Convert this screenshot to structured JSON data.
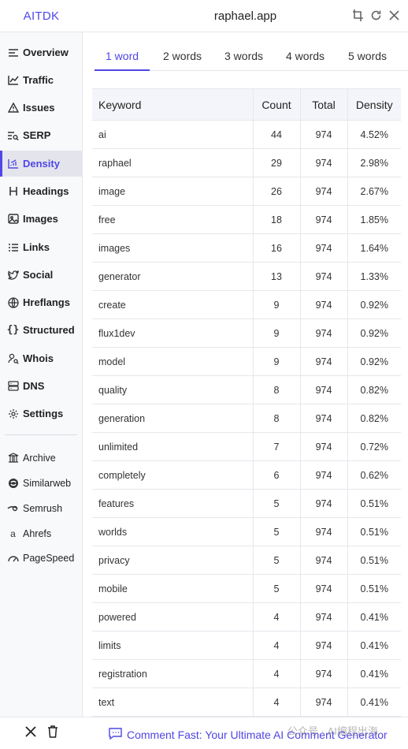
{
  "header": {
    "brand": "AITDK",
    "domain": "raphael.app"
  },
  "sidebar": {
    "items": [
      {
        "label": "Overview",
        "icon": "list-icon"
      },
      {
        "label": "Traffic",
        "icon": "chart-line-icon"
      },
      {
        "label": "Issues",
        "icon": "warning-icon"
      },
      {
        "label": "SERP",
        "icon": "serp-icon"
      },
      {
        "label": "Density",
        "icon": "density-chart-icon",
        "active": true
      },
      {
        "label": "Headings",
        "icon": "heading-icon"
      },
      {
        "label": "Images",
        "icon": "image-icon"
      },
      {
        "label": "Links",
        "icon": "links-list-icon"
      },
      {
        "label": "Social",
        "icon": "twitter-icon"
      },
      {
        "label": "Hreflangs",
        "icon": "globe-icon"
      },
      {
        "label": "Structured",
        "icon": "braces-icon"
      },
      {
        "label": "Whois",
        "icon": "user-search-icon"
      },
      {
        "label": "DNS",
        "icon": "server-icon"
      },
      {
        "label": "Settings",
        "icon": "gear-icon"
      }
    ],
    "external": [
      {
        "label": "Archive",
        "icon": "archive-icon"
      },
      {
        "label": "Similarweb",
        "icon": "similarweb-icon"
      },
      {
        "label": "Semrush",
        "icon": "semrush-icon"
      },
      {
        "label": "Ahrefs",
        "icon": "ahrefs-icon"
      },
      {
        "label": "PageSpeed",
        "icon": "pagespeed-icon"
      }
    ]
  },
  "tabs": [
    "1 word",
    "2 words",
    "3 words",
    "4 words",
    "5 words"
  ],
  "table": {
    "headers": {
      "keyword": "Keyword",
      "count": "Count",
      "total": "Total",
      "density": "Density"
    },
    "rows": [
      [
        "ai",
        "44",
        "974",
        "4.52%"
      ],
      [
        "raphael",
        "29",
        "974",
        "2.98%"
      ],
      [
        "image",
        "26",
        "974",
        "2.67%"
      ],
      [
        "free",
        "18",
        "974",
        "1.85%"
      ],
      [
        "images",
        "16",
        "974",
        "1.64%"
      ],
      [
        "generator",
        "13",
        "974",
        "1.33%"
      ],
      [
        "create",
        "9",
        "974",
        "0.92%"
      ],
      [
        "flux1dev",
        "9",
        "974",
        "0.92%"
      ],
      [
        "model",
        "9",
        "974",
        "0.92%"
      ],
      [
        "quality",
        "8",
        "974",
        "0.82%"
      ],
      [
        "generation",
        "8",
        "974",
        "0.82%"
      ],
      [
        "unlimited",
        "7",
        "974",
        "0.72%"
      ],
      [
        "completely",
        "6",
        "974",
        "0.62%"
      ],
      [
        "features",
        "5",
        "974",
        "0.51%"
      ],
      [
        "worlds",
        "5",
        "974",
        "0.51%"
      ],
      [
        "privacy",
        "5",
        "974",
        "0.51%"
      ],
      [
        "mobile",
        "5",
        "974",
        "0.51%"
      ],
      [
        "powered",
        "4",
        "974",
        "0.41%"
      ],
      [
        "limits",
        "4",
        "974",
        "0.41%"
      ],
      [
        "registration",
        "4",
        "974",
        "0.41%"
      ],
      [
        "text",
        "4",
        "974",
        "0.41%"
      ]
    ]
  },
  "footer": {
    "link_text": "Comment Fast: Your Ultimate AI Comment Generator",
    "watermark": "公众号 · AI编程出海"
  },
  "colors": {
    "accent": "#4f46e5",
    "sidebar_bg": "#f8f9fb",
    "active_bg": "#e4e5ec"
  }
}
